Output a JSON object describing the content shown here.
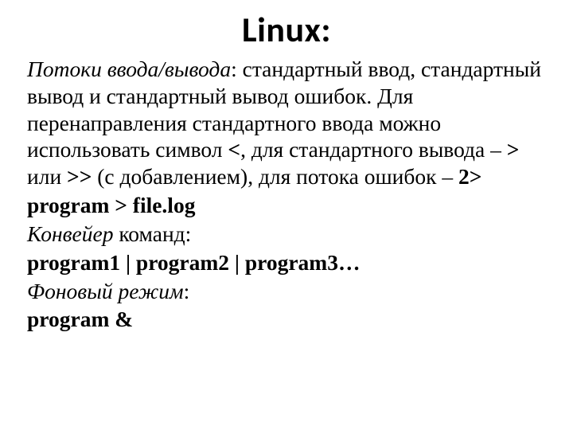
{
  "title": "Linux:",
  "p1_a": "Потоки ввода/вывода",
  "p1_b": ": стандартный ввод, стандартный вывод и стандартный вывод ошибок. Для перенаправления стандартного ввода можно использовать символ ",
  "p1_c": "<",
  "p1_d": ", для стандартного вывода – ",
  "p1_e": ">",
  "p1_f": " или ",
  "p1_g": ">>",
  "p1_h": " (с добавлением), для потока ошибок – ",
  "p1_i": "2>",
  "p2": "program > file.log",
  "p3_a": "Конвейер",
  "p3_b": " команд:",
  "p4": "program1 | program2 | program3…",
  "p5_a": "Фоновый режим",
  "p5_b": ":",
  "p6": "program &"
}
